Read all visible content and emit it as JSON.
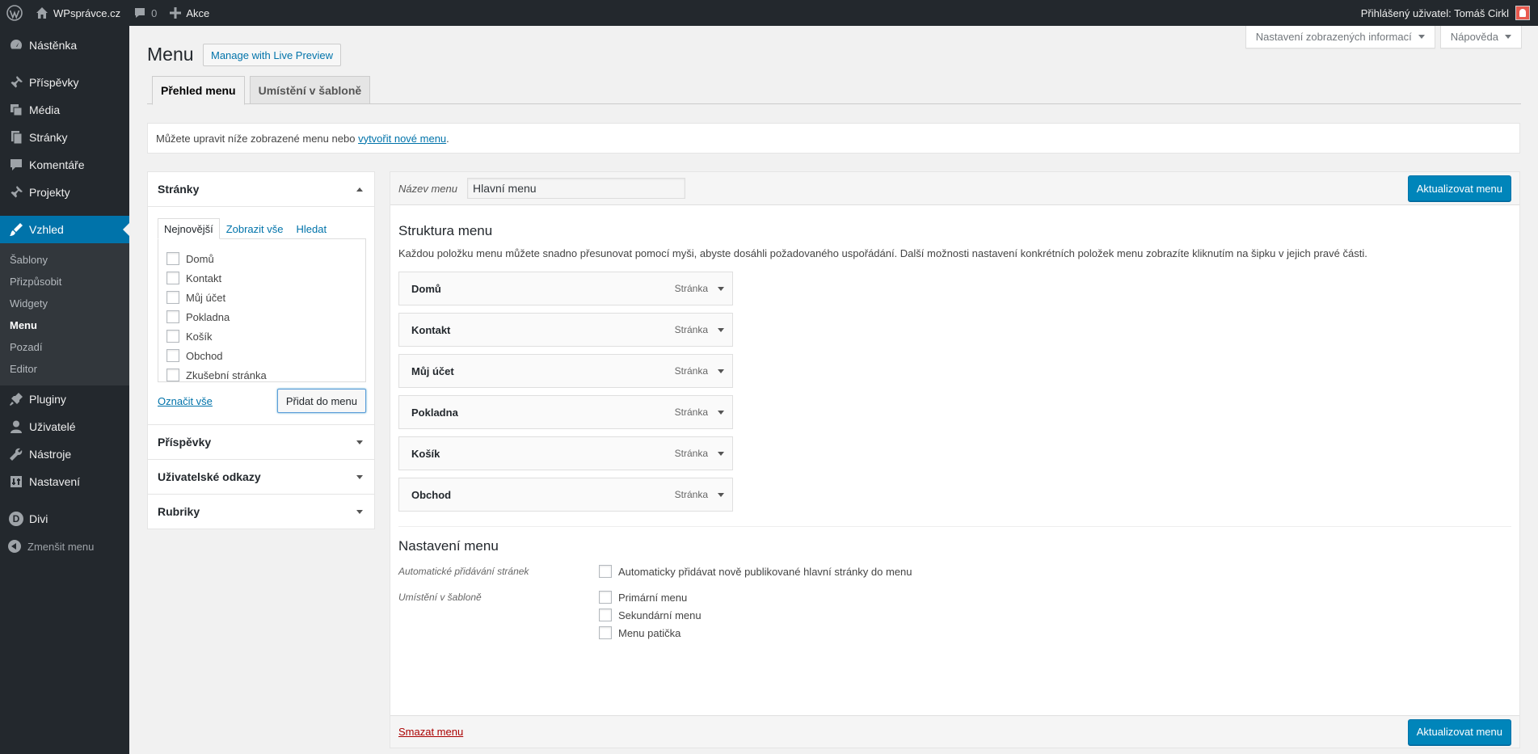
{
  "adminbar": {
    "site_name": "WPsprávce.cz",
    "comment_count": "0",
    "new_label": "Akce",
    "user_greeting": "Přihlášený uživatel: Tomáš Cirkl"
  },
  "sidebar": {
    "items": [
      {
        "label": "Nástěnka",
        "icon": "dashboard-icon"
      },
      {
        "label": "Příspěvky",
        "icon": "pin-icon"
      },
      {
        "label": "Média",
        "icon": "media-icon"
      },
      {
        "label": "Stránky",
        "icon": "pages-icon"
      },
      {
        "label": "Komentáře",
        "icon": "comment-icon"
      },
      {
        "label": "Projekty",
        "icon": "pin-icon"
      },
      {
        "label": "Vzhled",
        "icon": "brush-icon"
      },
      {
        "label": "Pluginy",
        "icon": "plugin-icon"
      },
      {
        "label": "Uživatelé",
        "icon": "user-icon"
      },
      {
        "label": "Nástroje",
        "icon": "wrench-icon"
      },
      {
        "label": "Nastavení",
        "icon": "settings-icon"
      },
      {
        "label": "Divi",
        "icon": "divi-icon"
      },
      {
        "label": "Zmenšit menu",
        "icon": "collapse-icon"
      }
    ],
    "submenu": [
      "Šablony",
      "Přizpůsobit",
      "Widgety",
      "Menu",
      "Pozadí",
      "Editor"
    ]
  },
  "screen_options": {
    "screen_label": "Nastavení zobrazených informací",
    "help_label": "Nápověda"
  },
  "header": {
    "title": "Menu",
    "live_preview": "Manage with Live Preview",
    "tabs": [
      "Přehled menu",
      "Umístění v šabloně"
    ]
  },
  "notice": {
    "text": "Můžete upravit níže zobrazené menu nebo",
    "link": "vytvořit nové menu",
    "end": "."
  },
  "accordion": {
    "pages_title": "Stránky",
    "inner_tabs": [
      "Nejnovější",
      "Zobrazit vše",
      "Hledat"
    ],
    "pages": [
      "Domů",
      "Kontakt",
      "Můj účet",
      "Pokladna",
      "Košík",
      "Obchod",
      "Zkušební stránka"
    ],
    "select_all": "Označit vše",
    "add_button": "Přidat do menu",
    "sections": [
      "Příspěvky",
      "Uživatelské odkazy",
      "Rubriky"
    ]
  },
  "menu_edit": {
    "name_label": "Název menu",
    "name_value": "Hlavní menu",
    "save_button": "Aktualizovat menu",
    "structure_title": "Struktura menu",
    "structure_desc": "Každou položku menu můžete snadno přesunovat pomocí myši, abyste dosáhli požadovaného uspořádání. Další možnosti nastavení konkrétních položek menu zobrazíte kliknutím na šipku v jejich pravé části.",
    "items": [
      {
        "title": "Domů",
        "type": "Stránka"
      },
      {
        "title": "Kontakt",
        "type": "Stránka"
      },
      {
        "title": "Můj účet",
        "type": "Stránka"
      },
      {
        "title": "Pokladna",
        "type": "Stránka"
      },
      {
        "title": "Košík",
        "type": "Stránka"
      },
      {
        "title": "Obchod",
        "type": "Stránka"
      }
    ],
    "settings_title": "Nastavení menu",
    "auto_add_label": "Automatické přidávání stránek",
    "auto_add_option": "Automaticky přidávat nově publikované hlavní stránky do menu",
    "location_label": "Umístění v šabloně",
    "locations": [
      "Primární menu",
      "Sekundární menu",
      "Menu patička"
    ],
    "delete_link": "Smazat menu"
  },
  "colors": {
    "admin_dark": "#23282d",
    "accent": "#0073aa",
    "primary_button": "#0085ba",
    "delete": "#a00"
  }
}
